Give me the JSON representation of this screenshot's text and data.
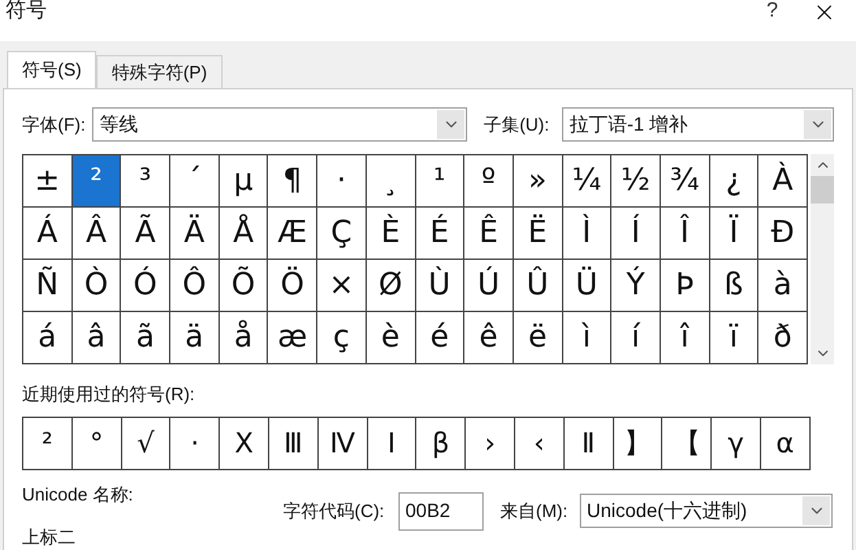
{
  "window": {
    "title": "符号",
    "help": "?"
  },
  "tabs": [
    {
      "label": "符号(S)",
      "selected": true
    },
    {
      "label": "特殊字符(P)",
      "selected": false
    }
  ],
  "font": {
    "label": "字体(F):",
    "value": "等线"
  },
  "subset": {
    "label": "子集(U):",
    "value": "拉丁语-1 增补"
  },
  "symbol_grid": [
    [
      {
        "char": "±",
        "selected": false
      },
      {
        "char": "²",
        "selected": true
      },
      {
        "char": "³",
        "selected": false
      },
      {
        "char": "´",
        "selected": false
      },
      {
        "char": "µ",
        "selected": false
      },
      {
        "char": "¶",
        "selected": false
      },
      {
        "char": "·",
        "selected": false
      },
      {
        "char": "¸",
        "selected": false
      },
      {
        "char": "¹",
        "selected": false
      },
      {
        "char": "º",
        "selected": false
      },
      {
        "char": "»",
        "selected": false
      },
      {
        "char": "¼",
        "selected": false
      },
      {
        "char": "½",
        "selected": false
      },
      {
        "char": "¾",
        "selected": false
      },
      {
        "char": "¿",
        "selected": false
      },
      {
        "char": "À",
        "selected": false
      }
    ],
    [
      {
        "char": "Á",
        "selected": false
      },
      {
        "char": "Â",
        "selected": false
      },
      {
        "char": "Ã",
        "selected": false
      },
      {
        "char": "Ä",
        "selected": false
      },
      {
        "char": "Å",
        "selected": false
      },
      {
        "char": "Æ",
        "selected": false
      },
      {
        "char": "Ç",
        "selected": false
      },
      {
        "char": "È",
        "selected": false
      },
      {
        "char": "É",
        "selected": false
      },
      {
        "char": "Ê",
        "selected": false
      },
      {
        "char": "Ë",
        "selected": false
      },
      {
        "char": "Ì",
        "selected": false
      },
      {
        "char": "Í",
        "selected": false
      },
      {
        "char": "Î",
        "selected": false
      },
      {
        "char": "Ï",
        "selected": false
      },
      {
        "char": "Ð",
        "selected": false
      }
    ],
    [
      {
        "char": "Ñ",
        "selected": false
      },
      {
        "char": "Ò",
        "selected": false
      },
      {
        "char": "Ó",
        "selected": false
      },
      {
        "char": "Ô",
        "selected": false
      },
      {
        "char": "Õ",
        "selected": false
      },
      {
        "char": "Ö",
        "selected": false
      },
      {
        "char": "×",
        "selected": false
      },
      {
        "char": "Ø",
        "selected": false
      },
      {
        "char": "Ù",
        "selected": false
      },
      {
        "char": "Ú",
        "selected": false
      },
      {
        "char": "Û",
        "selected": false
      },
      {
        "char": "Ü",
        "selected": false
      },
      {
        "char": "Ý",
        "selected": false
      },
      {
        "char": "Þ",
        "selected": false
      },
      {
        "char": "ß",
        "selected": false
      },
      {
        "char": "à",
        "selected": false
      }
    ],
    [
      {
        "char": "á",
        "selected": false
      },
      {
        "char": "â",
        "selected": false
      },
      {
        "char": "ã",
        "selected": false
      },
      {
        "char": "ä",
        "selected": false
      },
      {
        "char": "å",
        "selected": false
      },
      {
        "char": "æ",
        "selected": false
      },
      {
        "char": "ç",
        "selected": false
      },
      {
        "char": "è",
        "selected": false
      },
      {
        "char": "é",
        "selected": false
      },
      {
        "char": "ê",
        "selected": false
      },
      {
        "char": "ë",
        "selected": false
      },
      {
        "char": "ì",
        "selected": false
      },
      {
        "char": "í",
        "selected": false
      },
      {
        "char": "î",
        "selected": false
      },
      {
        "char": "ï",
        "selected": false
      },
      {
        "char": "ð",
        "selected": false
      }
    ]
  ],
  "recent": {
    "label": "近期使用过的符号(R):",
    "symbols": [
      "²",
      "°",
      "√",
      "·",
      "Ⅹ",
      "Ⅲ",
      "Ⅳ",
      "Ⅰ",
      "β",
      "›",
      "‹",
      "Ⅱ",
      "】",
      "【",
      "γ",
      "α"
    ]
  },
  "unicode_name": {
    "label": "Unicode 名称:",
    "value": "上标二"
  },
  "char_code": {
    "label": "字符代码(C):",
    "value": "00B2"
  },
  "from": {
    "label": "来自(M):",
    "value": "Unicode(十六进制)"
  }
}
